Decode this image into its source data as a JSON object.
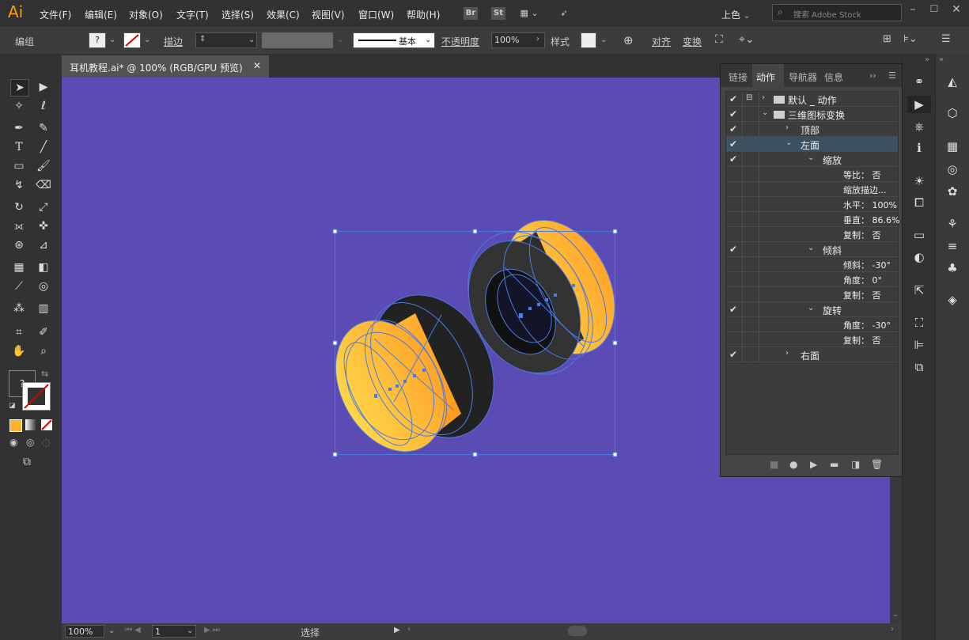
{
  "app": {
    "logo": "Ai"
  },
  "menu": [
    "文件(F)",
    "编辑(E)",
    "对象(O)",
    "文字(T)",
    "选择(S)",
    "效果(C)",
    "视图(V)",
    "窗口(W)",
    "帮助(H)"
  ],
  "top_icons": {
    "br": "Br",
    "st": "St"
  },
  "workspace": "上色",
  "search": {
    "placeholder": "搜索 Adobe Stock"
  },
  "control": {
    "selection_label": "编组",
    "stroke_label": "描边",
    "stroke_style": "基本",
    "opacity_label": "不透明度",
    "opacity_value": "100%",
    "style_label": "样式",
    "align_label": "对齐",
    "transform_label": "变换"
  },
  "document": {
    "tab_title": "耳机教程.ai* @ 100% (RGB/GPU 预览)"
  },
  "status": {
    "zoom": "100%",
    "artboard": "1",
    "tool": "选择"
  },
  "panel": {
    "tabs": [
      "链接",
      "动作",
      "导航器",
      "信息"
    ],
    "rows": [
      {
        "label": "默认 _ 动作",
        "check": "✔",
        "level": 0,
        "arrow": "›",
        "folder": true
      },
      {
        "label": "三维图标变换",
        "check": "✔",
        "level": 0,
        "arrow": "⌄",
        "folder": true
      },
      {
        "label": "顶部",
        "check": "✔",
        "level": 1,
        "arrow": "›"
      },
      {
        "label": "左面",
        "check": "✔",
        "level": 1,
        "arrow": "⌄",
        "selected": true
      },
      {
        "label": "缩放",
        "check": "✔",
        "level": 2,
        "arrow": "⌄"
      },
      {
        "label": "等比： 否",
        "check": "",
        "level": 3
      },
      {
        "label": "缩放描边...",
        "check": "",
        "level": 3
      },
      {
        "label": "水平： 100%",
        "check": "",
        "level": 3
      },
      {
        "label": "垂直： 86.6%",
        "check": "",
        "level": 3
      },
      {
        "label": "复制： 否",
        "check": "",
        "level": 3
      },
      {
        "label": "倾斜",
        "check": "✔",
        "level": 2,
        "arrow": "⌄"
      },
      {
        "label": "倾斜： -30°",
        "check": "",
        "level": 3
      },
      {
        "label": "角度： 0°",
        "check": "",
        "level": 3
      },
      {
        "label": "复制： 否",
        "check": "",
        "level": 3
      },
      {
        "label": "旋转",
        "check": "✔",
        "level": 2,
        "arrow": "⌄"
      },
      {
        "label": "角度： -30°",
        "check": "",
        "level": 3
      },
      {
        "label": "复制： 否",
        "check": "",
        "level": 3
      },
      {
        "label": "右面",
        "check": "✔",
        "level": 1,
        "arrow": "›"
      }
    ]
  },
  "colors": {
    "canvas": "#5b4bb5",
    "accent": "#ff9a00",
    "selection": "#4a7be0"
  }
}
